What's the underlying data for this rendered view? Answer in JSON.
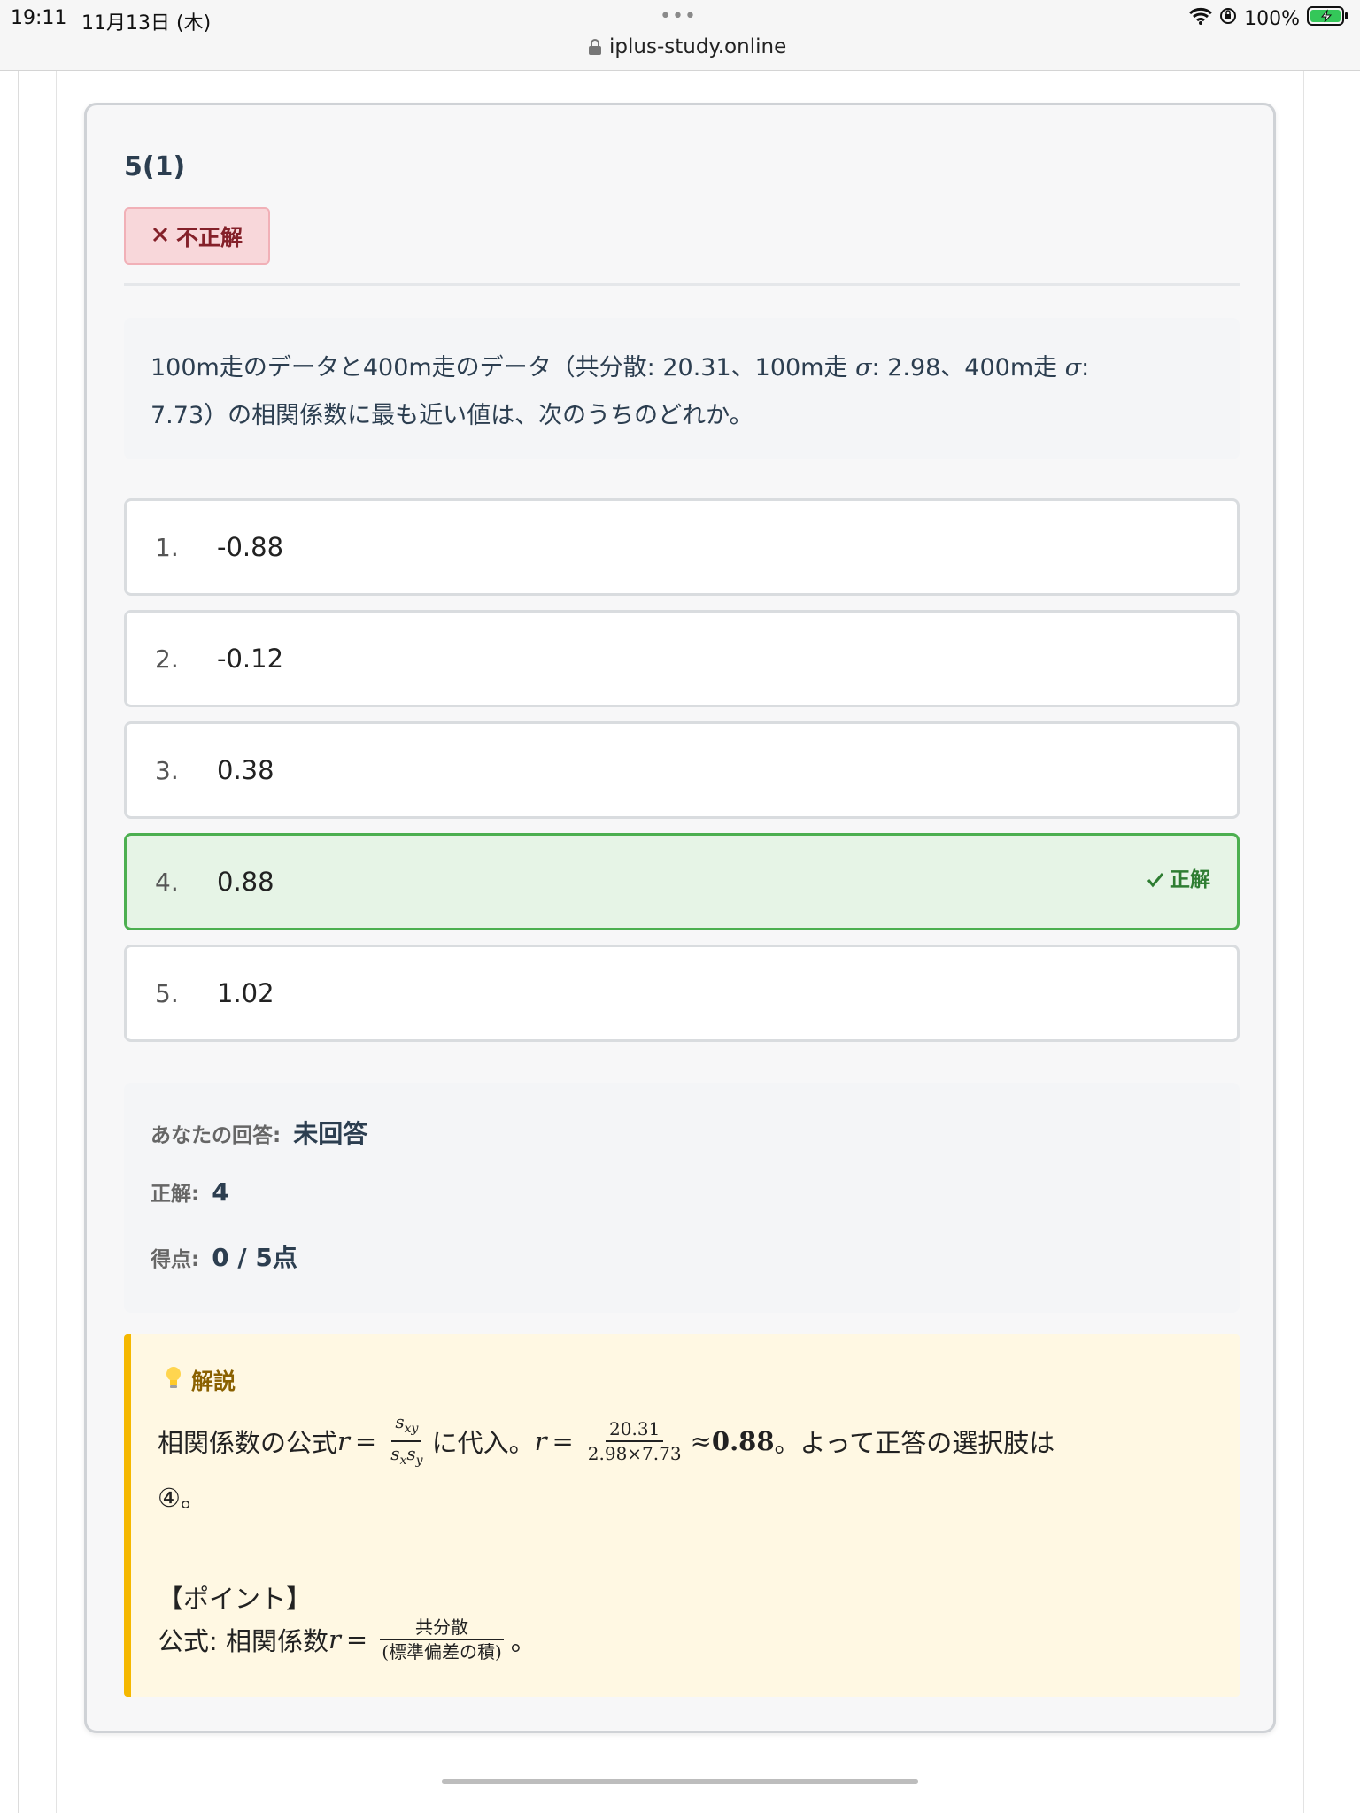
{
  "status_bar": {
    "time": "19:11",
    "date": "11月13日 (木)",
    "dots": "•••",
    "url": "iplus-study.online",
    "battery": "100%"
  },
  "question": {
    "number": "5(1)",
    "result_badge": "不正解",
    "text_part1": "100m走のデータと400m走のデータ（共分散: 20.31、100m走 ",
    "sigma1": "σ",
    "text_part2": ": 2.98、400m走 ",
    "sigma2": "σ",
    "text_part3": ":",
    "text_line2": "7.73）の相関係数に最も近い値は、次のうちのどれか。"
  },
  "choices": [
    {
      "num": "1.",
      "value": "-0.88",
      "tag": ""
    },
    {
      "num": "2.",
      "value": "-0.12",
      "tag": ""
    },
    {
      "num": "3.",
      "value": "0.38",
      "tag": ""
    },
    {
      "num": "4.",
      "value": "0.88",
      "tag": "正解"
    },
    {
      "num": "5.",
      "value": "1.02",
      "tag": ""
    }
  ],
  "result": {
    "your_answer_label": "あなたの回答:",
    "your_answer_value": "未回答",
    "correct_label": "正解:",
    "correct_value": "4",
    "score_label": "得点:",
    "score_value": "0 / 5点"
  },
  "explanation": {
    "heading": "解説",
    "line1_a": "相関係数の公式 ",
    "line1_r": "r",
    "line1_eq": " = ",
    "frac1_num": "sxy",
    "frac1_den": "sxsy",
    "line1_b": " に代入。 ",
    "line1_r2": "r",
    "line1_eq2": " = ",
    "frac2_num": "20.31",
    "frac2_den": "2.98×7.73",
    "line1_approx": " ≈ ",
    "line1_val": "0.88",
    "line1_c": "。よって正答の選択肢は",
    "line2": "④。",
    "point_head": "【ポイント】",
    "point_a": "公式: 相関係数 ",
    "point_r": "r",
    "point_eq": " = ",
    "frac3_num": "共分散",
    "frac3_den": "(標準偏差の積)",
    "point_end": "。"
  }
}
